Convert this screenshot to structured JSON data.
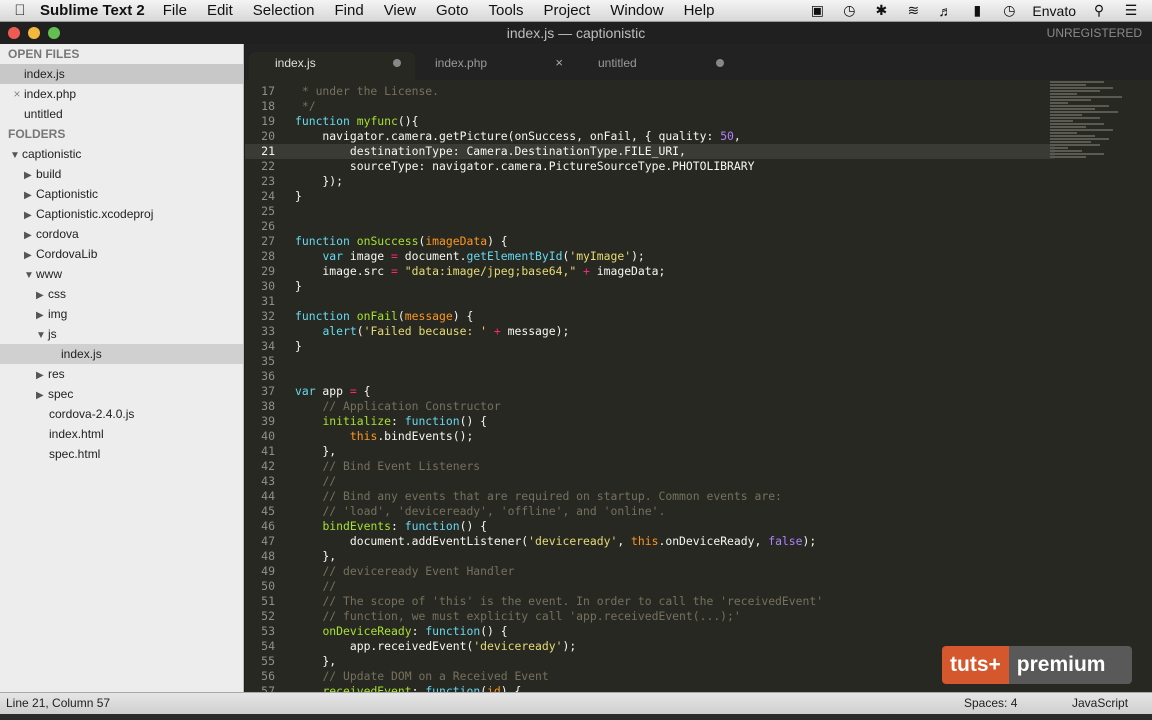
{
  "menubar": {
    "app_name": "Sublime Text 2",
    "menus": [
      "File",
      "Edit",
      "Selection",
      "Find",
      "View",
      "Goto",
      "Tools",
      "Project",
      "Window",
      "Help"
    ],
    "user": "Envato"
  },
  "window": {
    "title": "index.js — captionistic",
    "registration": "UNREGISTERED"
  },
  "sidebar": {
    "open_files_header": "OPEN FILES",
    "open_files": [
      "index.js",
      "index.php",
      "untitled"
    ],
    "folders_header": "FOLDERS",
    "tree": [
      "captionistic",
      "build",
      "Captionistic",
      "Captionistic.xcodeproj",
      "cordova",
      "CordovaLib",
      "www",
      "css",
      "img",
      "js",
      "index.js",
      "res",
      "spec",
      "cordova-2.4.0.js",
      "index.html",
      "spec.html"
    ]
  },
  "tabs": [
    "index.js",
    "index.php",
    "untitled"
  ],
  "editor": {
    "line_numbers": [
      "17",
      "18",
      "19",
      "20",
      "21",
      "22",
      "23",
      "24",
      "25",
      "26",
      "27",
      "28",
      "29",
      "30",
      "31",
      "32",
      "33",
      "34",
      "35",
      "36",
      "37",
      "38",
      "39",
      "40",
      "41",
      "42",
      "43",
      "44",
      "45",
      "46",
      "47",
      "48",
      "49",
      "50",
      "51",
      "52",
      "53",
      "54",
      "55",
      "56",
      "57"
    ],
    "current_line": "21"
  },
  "badge": {
    "left": "tuts+",
    "right": "premium"
  },
  "statusbar": {
    "position": "Line 21, Column 57",
    "indent": "Spaces: 4",
    "syntax": "JavaScript"
  },
  "colors": {
    "background": "#272822",
    "keyword": "#f92672",
    "function": "#a6e22e",
    "string": "#e6db74",
    "comment": "#75715e",
    "storage": "#66d9ef",
    "badge_orange": "#d5572d"
  }
}
